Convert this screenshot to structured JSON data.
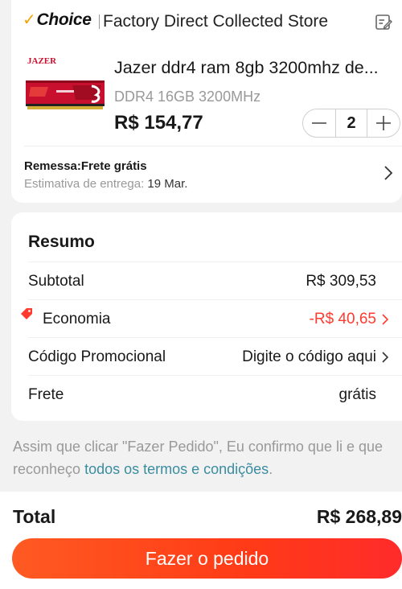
{
  "store": {
    "badge": "Choice",
    "name": "Factory Direct Collected Store",
    "edit_icon": "edit-icon"
  },
  "product": {
    "brand_logo": "JAZER",
    "title": "Jazer ddr4 ram 8gb 3200mhz de...",
    "variant": "DDR4 16GB 3200MHz",
    "price": "R$ 154,77",
    "quantity": "2"
  },
  "shipping": {
    "title": "Remessa:Frete grátis",
    "estimate_label": "Estimativa de entrega: ",
    "estimate_date": "19 Mar."
  },
  "summary": {
    "title": "Resumo",
    "rows": [
      {
        "label": "Subtotal",
        "value": "R$ 309,53"
      },
      {
        "label": "Economia",
        "value": "-R$ 40,65"
      },
      {
        "label": "Código Promocional",
        "value": "Digite o código aqui"
      },
      {
        "label": "Frete",
        "value": "grátis"
      }
    ]
  },
  "terms": {
    "text": "Assim que clicar \"Fazer Pedido\", Eu confirmo que li e que reconheço ",
    "link": "todos os termos e condições",
    "end": "."
  },
  "footer": {
    "total_label": "Total",
    "total_value": "R$ 268,89",
    "order_button": "Fazer o pedido"
  },
  "colors": {
    "accent": "#ff3b30",
    "choice_check": "#f4a300",
    "link": "#3a8ca0",
    "button_start": "#ff5a22",
    "button_end": "#ff2b2b"
  }
}
